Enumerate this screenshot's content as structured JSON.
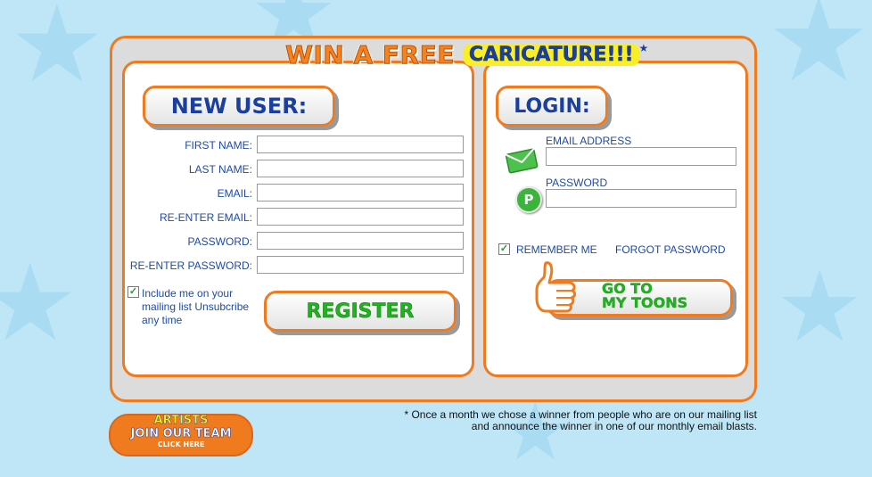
{
  "header": {
    "title_part1": "WIN A FREE",
    "title_part2": "CARICATURE!!!"
  },
  "new_user": {
    "heading": "NEW USER:",
    "fields": [
      {
        "label": "FIRST NAME:",
        "value": ""
      },
      {
        "label": "LAST NAME:",
        "value": ""
      },
      {
        "label": "EMAIL:",
        "value": ""
      },
      {
        "label": "RE-ENTER EMAIL:",
        "value": ""
      },
      {
        "label": "PASSWORD:",
        "value": ""
      },
      {
        "label": "RE-ENTER PASSWORD:",
        "value": ""
      }
    ],
    "mailing_list_checked": true,
    "mailing_list_text": "Include me on your mailing list Unsubcribe any time",
    "register_label": "REGISTER"
  },
  "login": {
    "heading": "LOGIN:",
    "email_label": "EMAIL ADDRESS",
    "email_value": "",
    "password_label": "PASSWORD",
    "password_value": "",
    "remember_checked": true,
    "remember_label": "REMEMBER ME",
    "forgot_label": "FORGOT PASSWORD",
    "go_label_line1": "GO TO",
    "go_label_line2": "MY TOONS"
  },
  "artists_banner": {
    "line1": "ARTISTS",
    "line2": "JOIN OUR TEAM",
    "line3": "CLICK HERE"
  },
  "footnote": {
    "line1": "* Once a month we chose a winner from people who are on our mailing list",
    "line2": "and announce the winner in one of our monthly email blasts."
  },
  "colors": {
    "accent_orange": "#f07a1e",
    "heading_blue": "#1a3f9e",
    "button_green": "#1fb31f",
    "background_blue": "#bfe6f7"
  }
}
